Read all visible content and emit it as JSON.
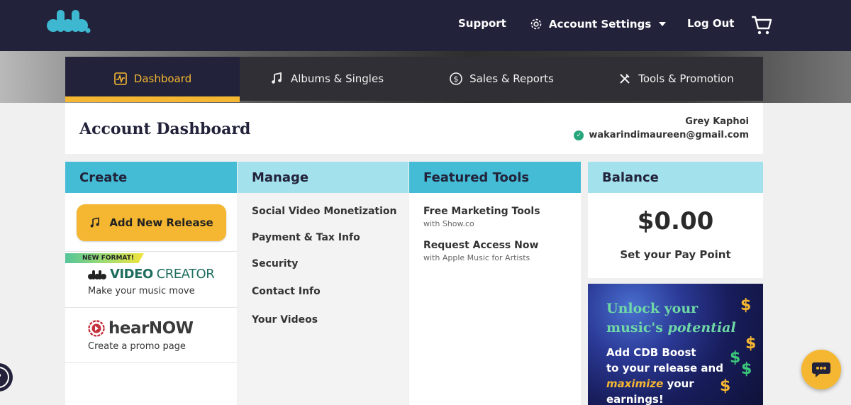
{
  "brand": {
    "logo_text": "cdb."
  },
  "header": {
    "support_label": "Support",
    "account_settings_label": "Account Settings",
    "logout_label": "Log Out",
    "cart_icon": "cart-icon"
  },
  "tabs": [
    {
      "label": "Dashboard",
      "icon": "pulse-icon",
      "active": true
    },
    {
      "label": "Albums & Singles",
      "icon": "music-notes-icon",
      "active": false
    },
    {
      "label": "Sales & Reports",
      "icon": "dollar-circle-icon",
      "active": false
    },
    {
      "label": "Tools & Promotion",
      "icon": "tools-icon",
      "active": false
    }
  ],
  "account": {
    "title": "Account Dashboard",
    "name": "Grey Kaphoi",
    "email": "wakarindimaureen@gmail.com"
  },
  "create": {
    "heading": "Create",
    "add_release_label": "Add New Release",
    "new_format_badge": "NEW FORMAT!",
    "video_creator": {
      "word1": "VIDEO",
      "word2": "CREATOR",
      "subtitle": "Make your music move"
    },
    "hearnow": {
      "logo_text": "hearNOW",
      "subtitle": "Create a promo page"
    }
  },
  "manage": {
    "heading": "Manage",
    "items": [
      "Social Video Monetization",
      "Payment & Tax Info",
      "Security",
      "Contact Info",
      "Your Videos"
    ]
  },
  "featured": {
    "heading": "Featured Tools",
    "items": [
      {
        "title": "Free Marketing Tools",
        "subtitle": "with Show.co"
      },
      {
        "title": "Request Access Now",
        "subtitle": "with Apple Music for Artists"
      }
    ]
  },
  "balance": {
    "heading": "Balance",
    "amount": "$0.00",
    "pay_point_label": "Set your Pay Point"
  },
  "promo": {
    "headline_1": "Unlock your",
    "headline_2a": "music's ",
    "headline_2b": "potential",
    "line_1": "Add CDB Boost",
    "line_2": "to your release and",
    "line_3_highlight": "maximize",
    "line_3_rest": " your",
    "line_4": "earnings!"
  },
  "colors": {
    "navy": "#22233a",
    "accent_yellow": "#f5b731",
    "teal": "#44bcd6",
    "light_teal": "#a3e1ec",
    "verified_green": "#26a67a"
  }
}
